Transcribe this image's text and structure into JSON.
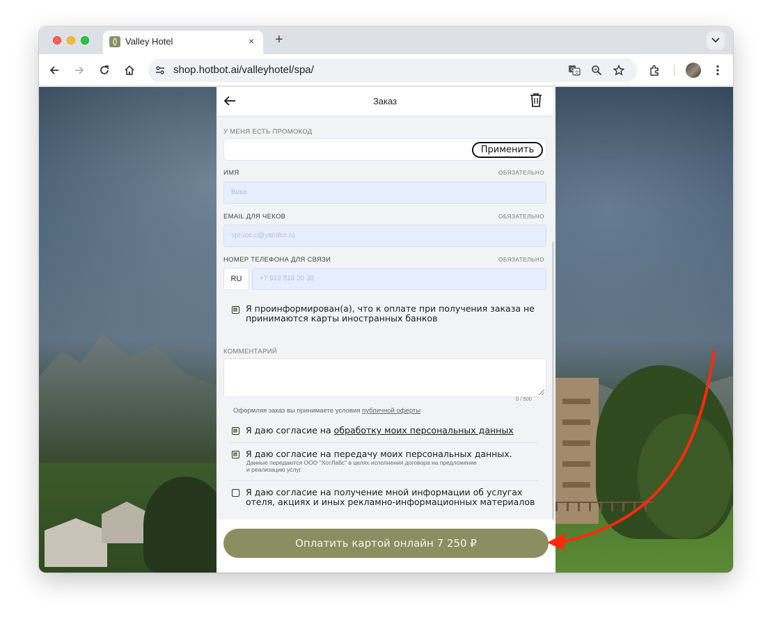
{
  "browser": {
    "tab_title": "Valley Hotel",
    "tab_close": "×",
    "new_tab": "+",
    "url": "shop.hotbot.ai/valleyhotel/spa/"
  },
  "page": {
    "header_title": "Заказ",
    "promo": {
      "label": "У МЕНЯ ЕСТЬ ПРОМОКОД",
      "apply_label": "Применить"
    },
    "name": {
      "label": "ИМЯ",
      "required": "ОБЯЗАТЕЛЬНО",
      "value": "Вика"
    },
    "email": {
      "label": "EMAIL ДЛЯ ЧЕКОВ",
      "required": "ОБЯЗАТЕЛЬНО",
      "value": "spruce.c@yandex.ru"
    },
    "phone": {
      "label": "НОМЕР ТЕЛЕФОНА ДЛЯ СВЯЗИ",
      "required": "ОБЯЗАТЕЛЬНО",
      "country": "RU",
      "value": "+7 913 818 20 38"
    },
    "foreign_cards_check": {
      "text_line1": "Я проинформирован(а), что к оплате при получения заказа не",
      "text_line2": "принимаются карты иностранных банков",
      "checked": true
    },
    "comment": {
      "label": "КОММЕНТАРИЙ",
      "counter": "0 / 500"
    },
    "terms": {
      "prefix": "Оформляя заказ вы принимаете условия ",
      "link": "публичной оферты"
    },
    "consents": [
      {
        "text": "Я даю согласие на ",
        "link": "обработку моих персональных данных",
        "checked": true
      },
      {
        "text": "Я даю согласие на передачу моих персональных данных.",
        "sub_line1": "Данные передаются ООО \"ХотЛабс\" в целях исполнения договора на предложение",
        "sub_line2": "и реализацию услуг",
        "checked": true
      },
      {
        "text_line1": "Я даю согласие на получение мной информации об услугах",
        "text_line2": "отеля, акциях и иных рекламно-информационных материалов",
        "checked": false
      }
    ],
    "pay_button": "Оплатить картой онлайн 7 250 ₽"
  },
  "colors": {
    "accent": "#8a8f62",
    "annotation_arrow": "#ff2a0d",
    "input_bg": "#e6eeff"
  }
}
